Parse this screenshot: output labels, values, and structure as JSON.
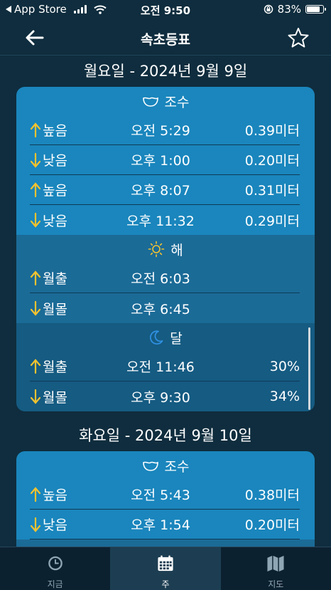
{
  "status_bar": {
    "back_app": "App Store",
    "time": "오전 9:50",
    "battery": "83%",
    "battery_level": 0.83
  },
  "nav": {
    "title": "속초등표"
  },
  "days": [
    {
      "title": "월요일 - 2024년 9월 9일",
      "tide": {
        "heading": "조수",
        "rows": [
          {
            "dir": "up",
            "label": "높음",
            "time": "오전 5:29",
            "value": "0.39미터"
          },
          {
            "dir": "down",
            "label": "낮음",
            "time": "오후 1:00",
            "value": "0.20미터"
          },
          {
            "dir": "up",
            "label": "높음",
            "time": "오후 8:07",
            "value": "0.31미터"
          },
          {
            "dir": "down",
            "label": "낮음",
            "time": "오후 11:32",
            "value": "0.29미터"
          }
        ]
      },
      "sun": {
        "heading": "해",
        "rows": [
          {
            "dir": "up",
            "label": "월출",
            "time": "오전 6:03",
            "value": ""
          },
          {
            "dir": "down",
            "label": "월몰",
            "time": "오후 6:45",
            "value": ""
          }
        ]
      },
      "moon": {
        "heading": "달",
        "rows": [
          {
            "dir": "up",
            "label": "월출",
            "time": "오전 11:46",
            "value": "30%"
          },
          {
            "dir": "down",
            "label": "월몰",
            "time": "오후 9:30",
            "value": "34%"
          }
        ]
      }
    },
    {
      "title": "화요일 - 2024년 9월 10일",
      "tide": {
        "heading": "조수",
        "rows": [
          {
            "dir": "up",
            "label": "높음",
            "time": "오전 5:43",
            "value": "0.38미터"
          },
          {
            "dir": "down",
            "label": "낮음",
            "time": "오후 1:54",
            "value": "0.20미터"
          }
        ]
      }
    }
  ],
  "tabs": [
    {
      "label": "지금",
      "icon": "clock-icon",
      "active": false
    },
    {
      "label": "주",
      "icon": "calendar-icon",
      "active": true
    },
    {
      "label": "지도",
      "icon": "map-icon",
      "active": false
    }
  ],
  "colors": {
    "background": "#0f2d3e",
    "tide_section": "#1a86bd",
    "sun_section": "#1b6b97",
    "moon_section": "#155b82",
    "arrow": "#f2c230",
    "tab_bar": "#0c2130"
  }
}
